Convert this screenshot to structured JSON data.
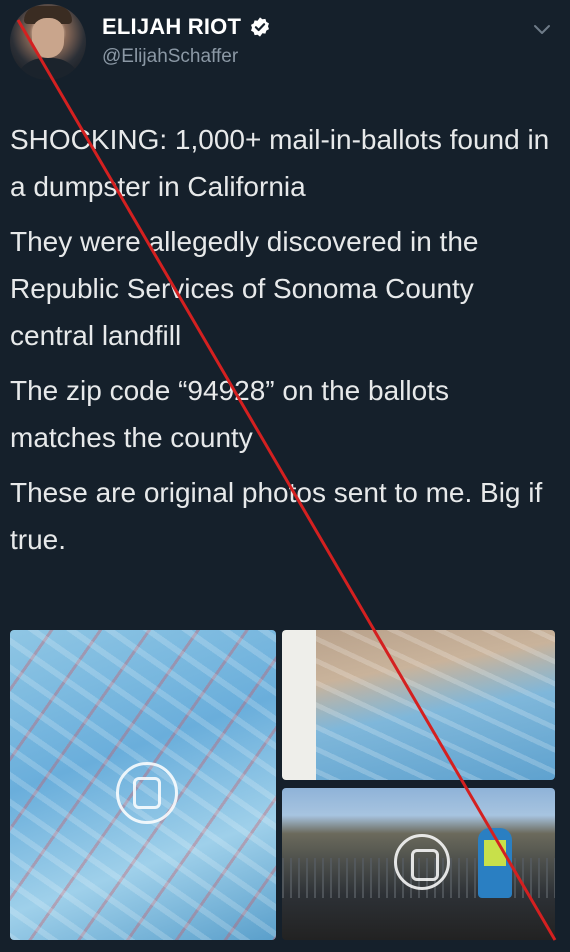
{
  "author": {
    "display_name": "ELIJAH RIOT",
    "handle": "@ElijahSchaffer",
    "verified": true,
    "avatar_icon": "profile-photo"
  },
  "tweet": {
    "paragraphs": [
      "SHOCKING: 1,000+ mail-in-ballots found in a dumpster in California",
      "They were allegedly discovered in the Republic Services of Sonoma County central landfill",
      "The zip code “94928” on the ballots matches the county",
      "These are original photos sent to me. Big if true."
    ]
  },
  "media": {
    "images": [
      {
        "description_icon": "photo-ballots-pile"
      },
      {
        "description_icon": "photo-dumpster"
      },
      {
        "description_icon": "photo-landfill-worker"
      }
    ]
  },
  "overlay": {
    "strike_color": "#d42020"
  },
  "colors": {
    "background": "#15202b",
    "text": "#e7e9ea",
    "secondary_text": "#8b98a5",
    "verified_badge": "#ffffff"
  }
}
